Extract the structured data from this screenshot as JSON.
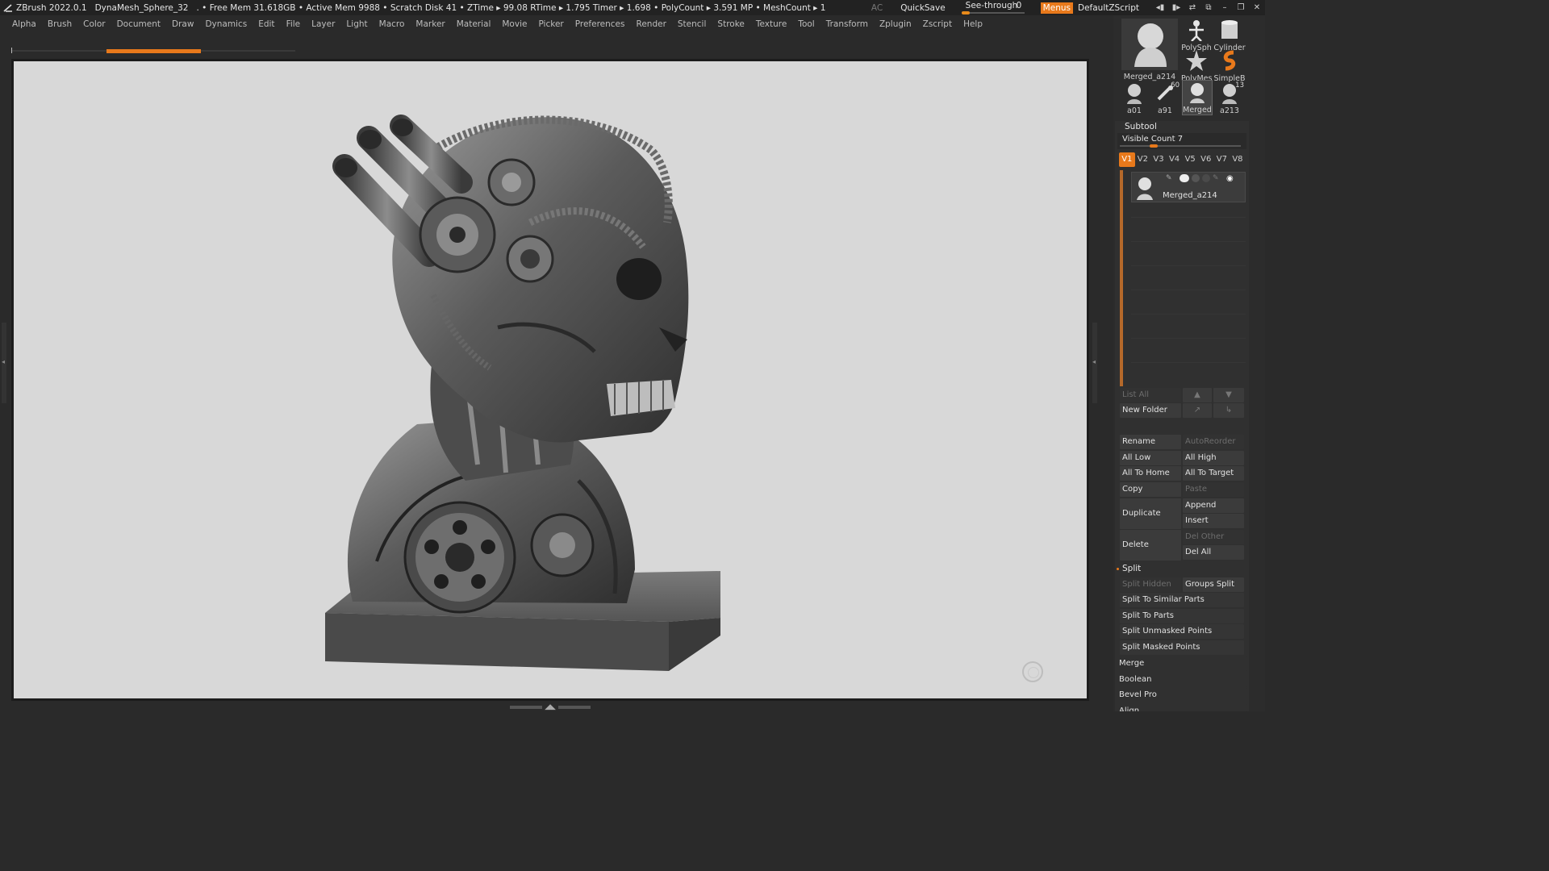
{
  "titlebar": {
    "app": "ZBrush 2022.0.1",
    "document": "DynaMesh_Sphere_32",
    "status": ". • Free Mem 31.618GB • Active Mem 9988 • Scratch Disk 41 • ZTime ▸ 99.08 RTime ▸ 1.795 Timer ▸ 1.698 • PolyCount ▸ 3.591 MP • MeshCount ▸ 1",
    "ac": "AC",
    "quicksave": "QuickSave",
    "see_through_label": "See-through",
    "see_through_value": "0",
    "see_through_level": 0,
    "menus": "Menus",
    "default_zscript": "DefaultZScript"
  },
  "menubar": [
    "Alpha",
    "Brush",
    "Color",
    "Document",
    "Draw",
    "Dynamics",
    "Edit",
    "File",
    "Layer",
    "Light",
    "Macro",
    "Marker",
    "Material",
    "Movie",
    "Picker",
    "Preferences",
    "Render",
    "Stencil",
    "Stroke",
    "Texture",
    "Tool",
    "Transform",
    "Zplugin",
    "Zscript",
    "Help"
  ],
  "colors": {
    "accent": "#e8791b",
    "canvas_bg": "#d8d8d8",
    "panel_bg": "#2c2c2c"
  },
  "tool_thumbs": {
    "large": "Merged_a214",
    "polysphere": "PolySph",
    "cylinder": "Cylinder",
    "polymesh": "PolyMes",
    "simpleb": "SimpleB",
    "a01": "a01",
    "a91": "a91",
    "a91_badge": "60",
    "merged": "Merged",
    "a213": "a213",
    "a213_badge": "13"
  },
  "subtool": {
    "title": "Subtool",
    "visible_count_label": "Visible Count 7",
    "visible_count": 7,
    "v_tabs": [
      "V1",
      "V2",
      "V3",
      "V4",
      "V5",
      "V6",
      "V7",
      "V8"
    ],
    "active_tab": "V1",
    "item_name": "Merged_a214",
    "buttons": {
      "list_all": "List All",
      "new_folder": "New Folder",
      "rename": "Rename",
      "auto_reorder": "AutoReorder",
      "all_low": "All Low",
      "all_high": "All High",
      "all_to_home": "All To Home",
      "all_to_target": "All To Target",
      "copy": "Copy",
      "paste": "Paste",
      "duplicate": "Duplicate",
      "append": "Append",
      "insert": "Insert",
      "delete": "Delete",
      "del_other": "Del Other",
      "del_all": "Del All"
    },
    "split": {
      "title": "Split",
      "split_hidden": "Split Hidden",
      "groups_split": "Groups Split",
      "split_to_similar_parts": "Split To Similar Parts",
      "split_to_parts": "Split To Parts",
      "split_unmasked_points": "Split Unmasked Points",
      "split_masked_points": "Split Masked Points"
    },
    "merge": "Merge",
    "boolean": "Boolean",
    "bevel_pro": "Bevel Pro",
    "align": "Align"
  }
}
